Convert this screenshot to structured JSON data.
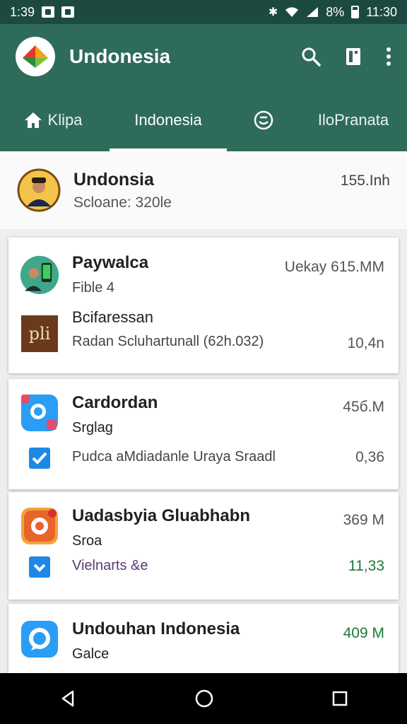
{
  "status_bar": {
    "time_left": "1:39",
    "battery": "8%",
    "time_right": "11:30"
  },
  "app_bar": {
    "title": "Undonesia"
  },
  "tabs": [
    {
      "label": "Klipa"
    },
    {
      "label": "Indonesia"
    },
    {
      "label": ""
    },
    {
      "label": "IloPranata"
    }
  ],
  "header": {
    "title": "Undonsia",
    "subtitle": "Scloane: 320le",
    "size": "155.Inh"
  },
  "cards": [
    {
      "title": "Paywalca",
      "subtitle": "Fible 4",
      "right": "Uekay 615.MM",
      "second_title": "Bcifaressan",
      "second_sub": "Radan Scluhartunall (62h.032)",
      "second_right": "10,4n"
    },
    {
      "title": "Cardordan",
      "subtitle": "Srglag",
      "right": "45б.M",
      "second_sub": "Pudca aMdiadanle Uraya Sraadl",
      "second_right": "0,36"
    },
    {
      "title": "Uadasbyia Gluabhabn",
      "subtitle": "Sroa",
      "right": "369 M",
      "second_sub": "Vielnarts &e",
      "second_right": "11,33"
    },
    {
      "title": "Undouhan Indonesia",
      "subtitle": "Galce",
      "right": "409 M"
    }
  ],
  "colors": {
    "app_bar": "#2f6b5b",
    "status_bar": "#1c4a40",
    "accent_blue": "#1e88e5",
    "green_text": "#1b7a38"
  }
}
